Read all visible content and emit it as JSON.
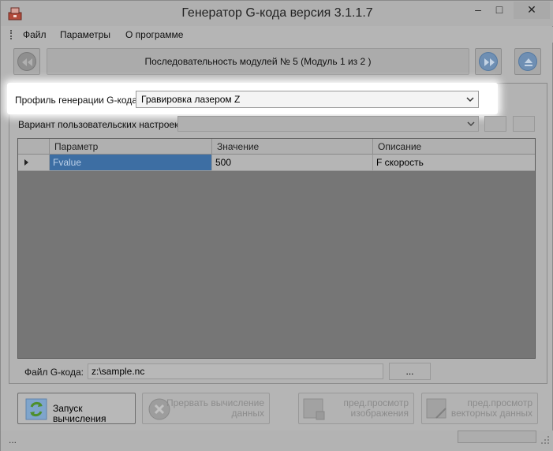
{
  "window": {
    "title": "Генератор G-кода версия 3.1.1.7",
    "minimize_glyph": "–",
    "maximize_glyph": "□",
    "close_glyph": "✕"
  },
  "menu": {
    "items": [
      {
        "label": "Файл"
      },
      {
        "label": "Параметры"
      },
      {
        "label": "О программе"
      }
    ]
  },
  "toolbar": {
    "sequence_text": "Последовательность модулей № 5 (Модуль 1 из 2 )",
    "prev_icon": "rewind-icon",
    "next_icon": "fast-forward-icon",
    "eject_icon": "eject-icon"
  },
  "profile": {
    "label": "Профиль генерации G-кода:",
    "value": "Гравировка лазером Z"
  },
  "user_settings": {
    "label": "Вариант пользовательских настроек:",
    "value": ""
  },
  "grid": {
    "columns": [
      "Параметр",
      "Значение",
      "Описание"
    ],
    "rows": [
      {
        "param": "Fvalue",
        "value": "500",
        "description": "F скорость"
      }
    ]
  },
  "file": {
    "label": "Файл G-кода:",
    "value": "z:\\sample.nc",
    "browse_label": "..."
  },
  "actions": {
    "run_label": "Запуск вычисления",
    "abort_line1": "Прервать вычисление",
    "abort_line2": "данных",
    "preview_image_line1": "пред.просмотр",
    "preview_image_line2": "изображения",
    "preview_vector_line1": "пред.просмотр",
    "preview_vector_line2": "векторных данных"
  },
  "status": {
    "text": "..."
  },
  "colors": {
    "accent_blue": "#3d6ea3",
    "nav_blue": "#6f8fb3",
    "highlight": "#ffffff"
  }
}
